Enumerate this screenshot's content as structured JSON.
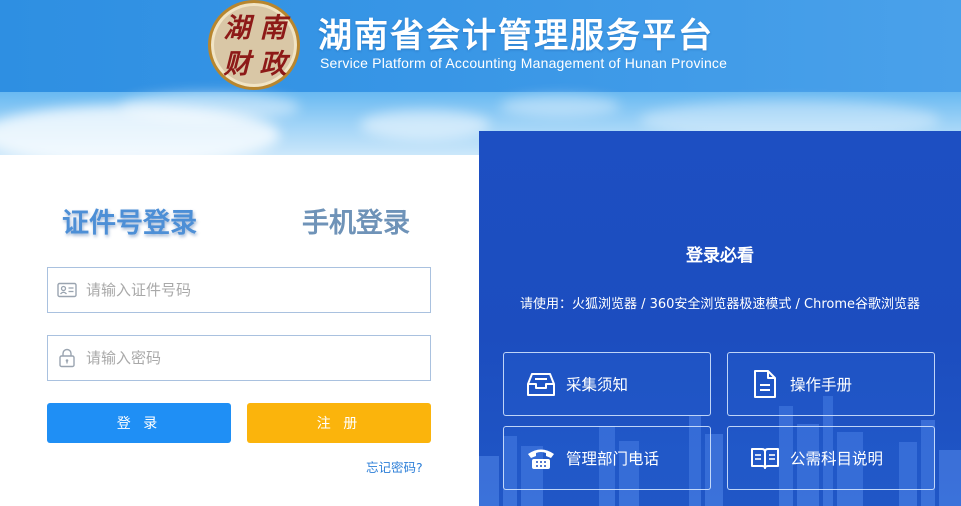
{
  "header": {
    "seal_characters": [
      "湖",
      "南",
      "财",
      "政"
    ],
    "title": "湖南省会计管理服务平台",
    "subtitle": "Service Platform of Accounting Management of Hunan Province"
  },
  "login": {
    "tabs": [
      {
        "label": "证件号登录",
        "active": true
      },
      {
        "label": "手机登录",
        "active": false
      }
    ],
    "id_field": {
      "placeholder": "请输入证件号码",
      "value": "",
      "icon": "id-card-icon"
    },
    "password_field": {
      "placeholder": "请输入密码",
      "value": "",
      "icon": "lock-icon"
    },
    "login_button": "登 录",
    "register_button": "注 册",
    "forgot_link": "忘记密码?"
  },
  "info": {
    "title": "登录必看",
    "browsers": "请使用：火狐浏览器 / 360安全浏览器极速模式 / Chrome谷歌浏览器",
    "cards": [
      {
        "label": "采集须知",
        "icon": "inbox-tray-icon"
      },
      {
        "label": "操作手册",
        "icon": "document-icon"
      },
      {
        "label": "管理部门电话",
        "icon": "telephone-icon"
      },
      {
        "label": "公需科目说明",
        "icon": "open-book-icon"
      }
    ]
  },
  "colors": {
    "header_blue": "#2e8fe2",
    "panel_blue": "#1d4fc2",
    "login_button": "#1f8ff5",
    "register_button": "#fbb40c",
    "active_tab": "#4d8fd6",
    "inactive_tab": "#6f93b8",
    "link": "#2d7fd8"
  }
}
